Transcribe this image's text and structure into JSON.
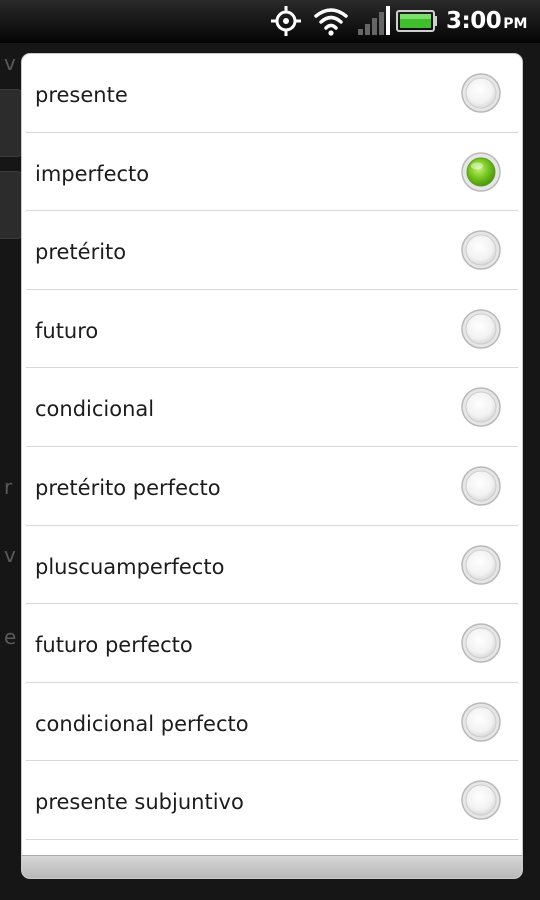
{
  "status_bar": {
    "time": "3:00",
    "ampm": "PM",
    "icons": [
      "gps-icon",
      "wifi-icon",
      "signal-icon",
      "battery-icon"
    ]
  },
  "background": {
    "letters": [
      "v",
      "r",
      "v",
      "e"
    ]
  },
  "tense_list": {
    "selected_index": 1,
    "accent_color": "#78c81e",
    "items": [
      {
        "label": "presente",
        "selected": false
      },
      {
        "label": "imperfecto",
        "selected": true
      },
      {
        "label": "pretérito",
        "selected": false
      },
      {
        "label": "futuro",
        "selected": false
      },
      {
        "label": "condicional",
        "selected": false
      },
      {
        "label": "pretérito perfecto",
        "selected": false
      },
      {
        "label": "pluscuamperfecto",
        "selected": false
      },
      {
        "label": "futuro perfecto",
        "selected": false
      },
      {
        "label": "condicional perfecto",
        "selected": false
      },
      {
        "label": "presente subjuntivo",
        "selected": false
      }
    ]
  }
}
